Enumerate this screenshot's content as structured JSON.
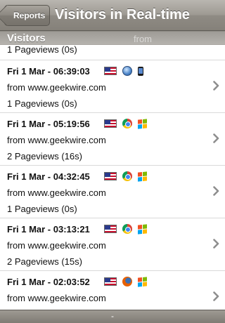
{
  "navbar": {
    "back_label": "Reports",
    "title": "Visitors in Real-time"
  },
  "section": {
    "title": "Visitors",
    "ghost_text": "from www.geekwire.com"
  },
  "partial_row": {
    "views": "1 Pageviews (0s)"
  },
  "rows": [
    {
      "date": "Fri 1 Mar - 06:39:03",
      "from": "from www.geekwire.com",
      "views": "1 Pageviews (0s)",
      "icons": [
        "us-flag-icon",
        "safari-globe-icon",
        "iphone-icon"
      ]
    },
    {
      "date": "Fri 1 Mar - 05:19:56",
      "from": "from www.geekwire.com",
      "views": "2 Pageviews (16s)",
      "icons": [
        "us-flag-icon",
        "chrome-icon",
        "windows-icon"
      ]
    },
    {
      "date": "Fri 1 Mar - 04:32:45",
      "from": "from www.geekwire.com",
      "views": "1 Pageviews (0s)",
      "icons": [
        "us-flag-icon",
        "chrome-icon",
        "windows-icon"
      ]
    },
    {
      "date": "Fri 1 Mar - 03:13:21",
      "from": "from www.geekwire.com",
      "views": "2 Pageviews (15s)",
      "icons": [
        "us-flag-icon",
        "chrome-icon",
        "windows-icon"
      ]
    },
    {
      "date": "Fri 1 Mar - 02:03:52",
      "from": "from www.geekwire.com",
      "views": "1 Pageviews (0s)",
      "icons": [
        "us-flag-icon",
        "firefox-icon",
        "windows-icon"
      ]
    }
  ],
  "toolbar": {
    "label": "-"
  },
  "colors": {
    "nav": "#9d9992",
    "divider": "#d9d9d9",
    "chevron": "#8e8e8e"
  }
}
